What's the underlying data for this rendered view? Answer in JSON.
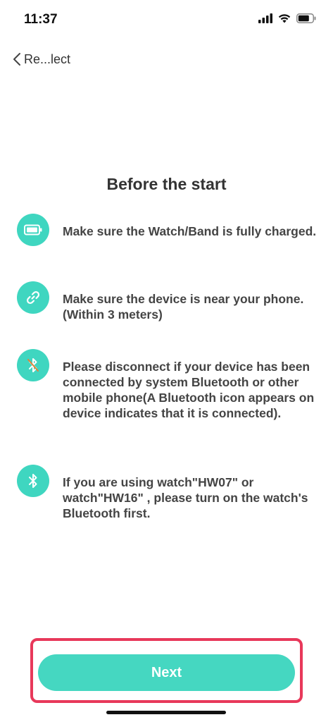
{
  "status_bar": {
    "time": "11:37",
    "icons": [
      "signal-icon",
      "wifi-icon",
      "battery-icon"
    ]
  },
  "nav": {
    "back_label": "Re...lect",
    "back_icon": "chevron-left-icon"
  },
  "title": "Before the start",
  "tips": [
    {
      "icon": "battery-icon",
      "text": "Make sure the Watch/Band is fully charged."
    },
    {
      "icon": "link-icon",
      "text": "Make sure the device is near your phone.(Within 3 meters)"
    },
    {
      "icon": "bluetooth-off-icon",
      "text": "Please disconnect if your device has been connected by system Bluetooth or other mobile phone(A Bluetooth icon appears on device indicates that it is connected)."
    },
    {
      "icon": "bluetooth-icon",
      "text": "If you are using  watch\"HW07\" or watch\"HW16\" , please turn on the watch's Bluetooth first."
    }
  ],
  "next_button": {
    "label": "Next"
  },
  "colors": {
    "accent": "#45d7c1",
    "highlight": "#e8385a",
    "icon_strike": "#e0843a"
  }
}
